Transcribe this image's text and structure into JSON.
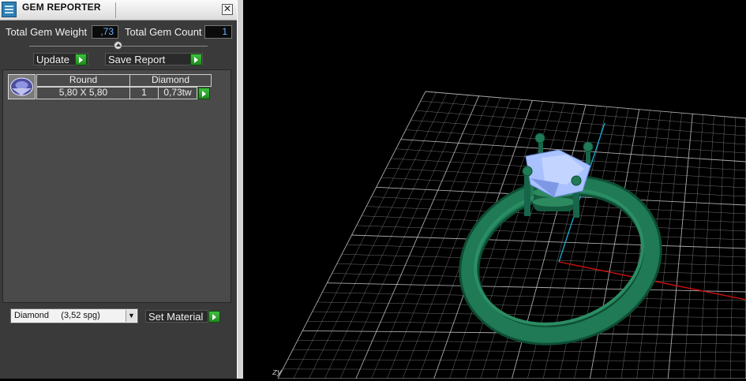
{
  "window": {
    "title": "GEM REPORTER",
    "close_symbol": "✕"
  },
  "stats": {
    "total_weight_label": "Total Gem Weight",
    "total_weight_value": ",73",
    "total_count_label": "Total Gem Count",
    "total_count_value": "1"
  },
  "actions": {
    "update_label": "Update",
    "save_label": "Save Report"
  },
  "gem_table": {
    "headers": [
      "Round",
      "Diamond"
    ],
    "rows": [
      {
        "size": "5,80 X 5,80",
        "count": "1",
        "weight": "0,73tw"
      }
    ]
  },
  "material": {
    "selected": "Diamond     (3,52 spg)",
    "set_label": "Set Material"
  },
  "viewport": {
    "axis_label": "zy"
  },
  "colors": {
    "ring": "#1f6b4c",
    "gem": "#a9c2ff",
    "grid": "#c8c8c8",
    "x_axis": "#d01010",
    "z_axis": "#1aa3c8"
  },
  "icons": [
    "app-icon",
    "close-icon",
    "slider-knob-icon",
    "play-arrow-icon",
    "gem-round-icon",
    "dropdown-arrow-icon"
  ]
}
